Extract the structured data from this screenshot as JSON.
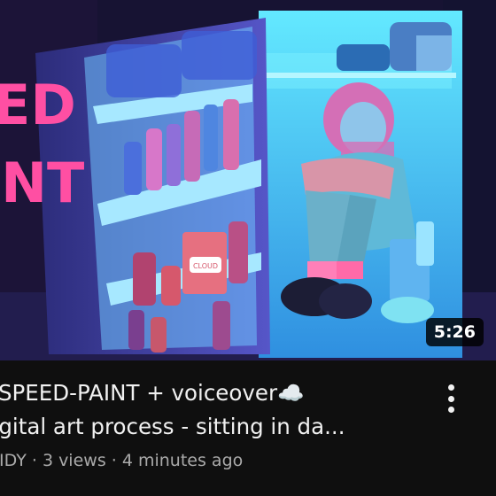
{
  "video": {
    "thumbnail_text_1": "ED",
    "thumbnail_text_2": "INT",
    "duration": "5:26",
    "title_line1": "☆SPEED-PAINT + voiceover☁️",
    "title_line2": "digital art process - sitting in da...",
    "channel": "AIDY",
    "views": "3 views",
    "age": "4 minutes ago",
    "meta_separator": " · ",
    "carton_label": "CLOUD",
    "menu_icon": "more-vertical-icon"
  }
}
